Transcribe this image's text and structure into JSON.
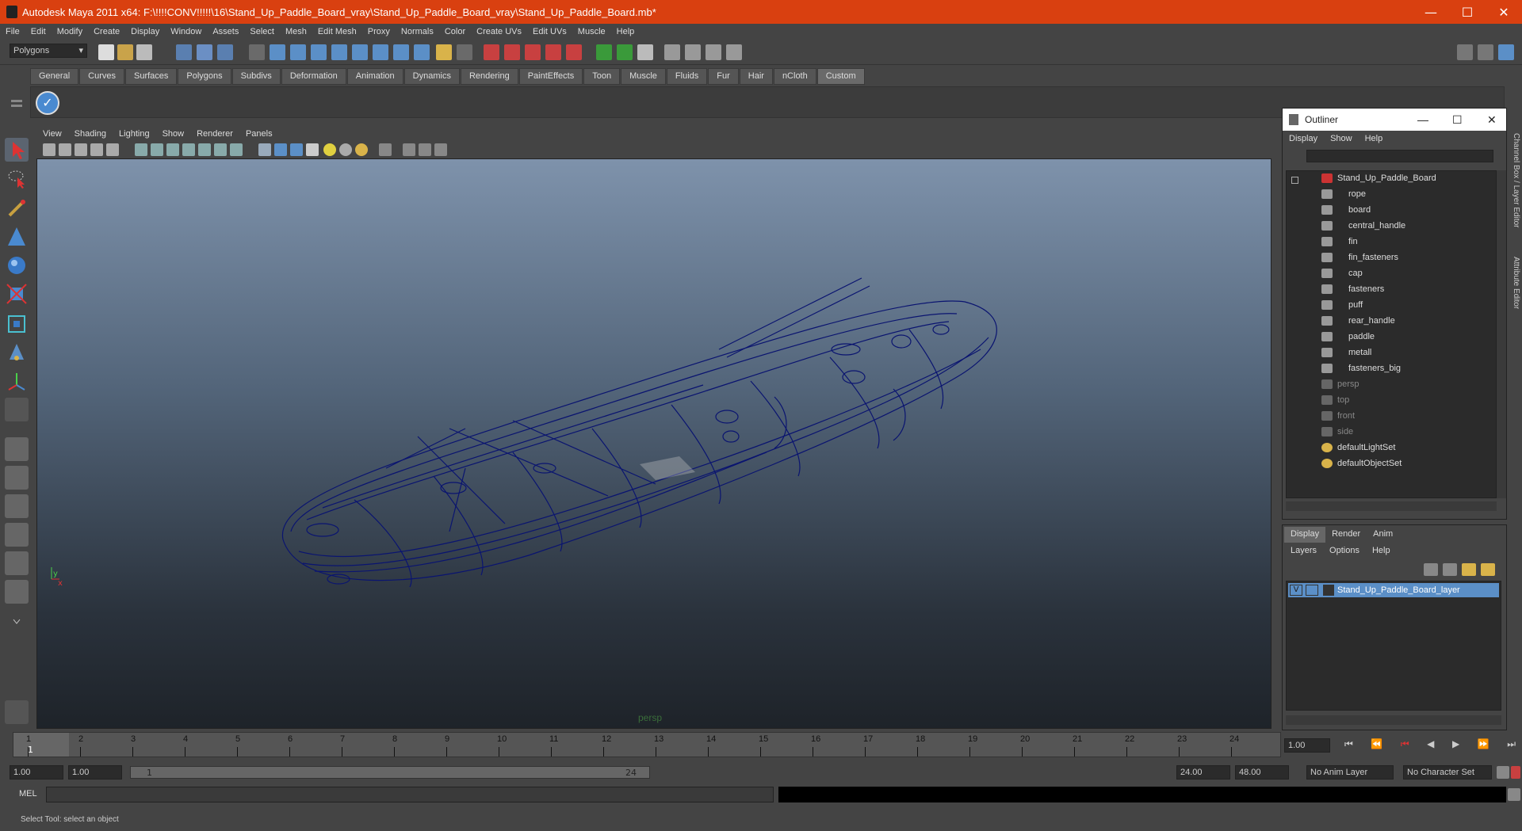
{
  "title_bar": {
    "title": "Autodesk Maya 2011 x64: F:\\!!!!CONV!!!!!\\16\\Stand_Up_Paddle_Board_vray\\Stand_Up_Paddle_Board_vray\\Stand_Up_Paddle_Board.mb*",
    "minimize": "—",
    "maximize": "☐",
    "close": "✕"
  },
  "menus": [
    "File",
    "Edit",
    "Modify",
    "Create",
    "Display",
    "Window",
    "Assets",
    "Select",
    "Mesh",
    "Edit Mesh",
    "Proxy",
    "Normals",
    "Color",
    "Create UVs",
    "Edit UVs",
    "Muscle",
    "Help"
  ],
  "status_line": {
    "menu_set": "Polygons"
  },
  "shelf_tabs": [
    "General",
    "Curves",
    "Surfaces",
    "Polygons",
    "Subdivs",
    "Deformation",
    "Animation",
    "Dynamics",
    "Rendering",
    "PaintEffects",
    "Toon",
    "Muscle",
    "Fluids",
    "Fur",
    "Hair",
    "nCloth",
    "Custom"
  ],
  "active_shelf_tab": "Custom",
  "viewport": {
    "menus": [
      "View",
      "Shading",
      "Lighting",
      "Show",
      "Renderer",
      "Panels"
    ],
    "camera_label": "persp",
    "axis_x": "x",
    "axis_y": "y"
  },
  "outliner": {
    "title": "Outliner",
    "menus": [
      "Display",
      "Show",
      "Help"
    ],
    "root": "Stand_Up_Paddle_Board",
    "children": [
      "rope",
      "board",
      "central_handle",
      "fin",
      "fin_fasteners",
      "cap",
      "fasteners",
      "puff",
      "rear_handle",
      "paddle",
      "metall",
      "fasteners_big"
    ],
    "cameras": [
      "persp",
      "top",
      "front",
      "side"
    ],
    "sets": [
      "defaultLightSet",
      "defaultObjectSet"
    ]
  },
  "layer_editor": {
    "tabs": [
      "Display",
      "Render",
      "Anim"
    ],
    "menus": [
      "Layers",
      "Options",
      "Help"
    ],
    "layer_visibility": "V",
    "layer_name": "Stand_Up_Paddle_Board_layer"
  },
  "side_tabs": {
    "channel_box": "Channel Box / Layer Editor",
    "attribute_editor": "Attribute Editor"
  },
  "timeline": {
    "ticks": [
      "1",
      "2",
      "3",
      "4",
      "5",
      "6",
      "7",
      "8",
      "9",
      "10",
      "11",
      "12",
      "13",
      "14",
      "15",
      "16",
      "17",
      "18",
      "19",
      "20",
      "21",
      "22",
      "23",
      "24"
    ],
    "current_frame_marker": "1",
    "current_time": "1.00"
  },
  "range": {
    "start_time": "1.00",
    "playback_start": "1.00",
    "range_start_label": "1",
    "range_end_label": "24",
    "playback_end": "24.00",
    "end_time": "48.00",
    "anim_layer": "No Anim Layer",
    "character_set": "No Character Set"
  },
  "command_line": {
    "label": "MEL"
  },
  "help_line": {
    "text": "Select Tool: select an object"
  },
  "colors": {
    "title_bar": "#d94010",
    "wireframe": "#0a1470",
    "selected_layer": "#5b8fc7"
  }
}
